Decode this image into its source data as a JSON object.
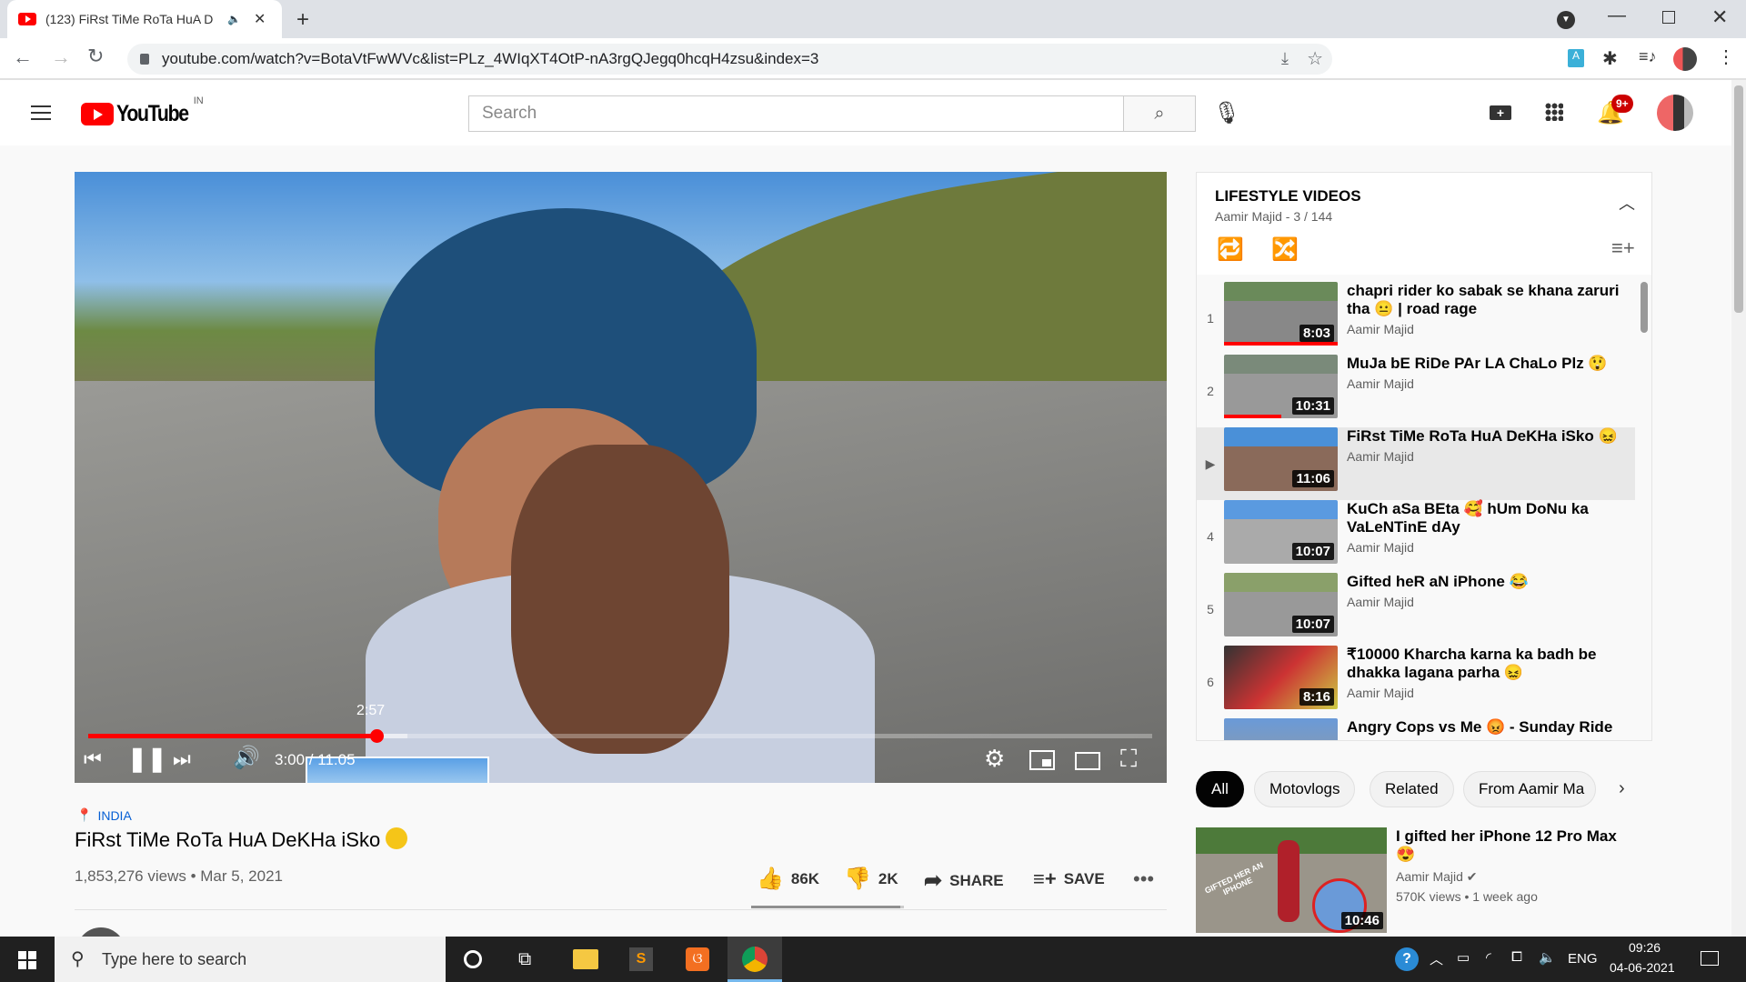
{
  "browser": {
    "tab_title": "(123) FiRst TiMe RoTa HuA D",
    "url": "youtube.com/watch?v=BotaVtFwWVc&list=PLz_4WIqXT4OtP-nA3rgQJegq0hcqH4zsu&index=3"
  },
  "header": {
    "logo": "YouTube",
    "region": "IN",
    "search_placeholder": "Search",
    "notif_badge": "9+"
  },
  "player": {
    "hover_time": "2:57",
    "time": "3:00 / 11:05",
    "progress": 0.271,
    "buffered": 0.3
  },
  "video": {
    "location": "INDIA",
    "title": "FiRst TiMe RoTa HuA DeKHa iSko",
    "views": "1,853,276 views • Mar 5, 2021",
    "likes": "86K",
    "dislikes": "2K",
    "share": "SHARE",
    "save": "SAVE",
    "like_ratio": 0.977
  },
  "playlist": {
    "title": "LIFESTYLE VIDEOS",
    "subtitle": "Aamir Majid - 3 / 144",
    "items": [
      {
        "num": "1",
        "title": "chapri rider ko sabak se khana zaruri tha 😐 | road rage",
        "channel": "Aamir Majid",
        "duration": "8:03"
      },
      {
        "num": "2",
        "title": "MuJa bE RiDe PAr LA ChaLo Plz 😲",
        "channel": "Aamir Majid",
        "duration": "10:31"
      },
      {
        "num": "▶",
        "title": "FiRst TiMe RoTa HuA DeKHa iSko 😖",
        "channel": "Aamir Majid",
        "duration": "11:06"
      },
      {
        "num": "4",
        "title": "KuCh aSa BEta 🥰 hUm DoNu ka VaLeNTinE dAy",
        "channel": "Aamir Majid",
        "duration": "10:07"
      },
      {
        "num": "5",
        "title": "Gifted heR aN iPhone 😂",
        "channel": "Aamir Majid",
        "duration": "10:07"
      },
      {
        "num": "6",
        "title": "₹10000 Kharcha karna ka badh be dhakka lagana parha 😖",
        "channel": "Aamir Majid",
        "duration": "8:16"
      },
      {
        "num": "",
        "title": "Angry Cops vs Me 😡 - Sunday Ride",
        "channel": "",
        "duration": ""
      }
    ]
  },
  "chips": [
    "All",
    "Motovlogs",
    "Related",
    "From Aamir Ma"
  ],
  "recommended": {
    "title": "I gifted her iPhone 12 Pro Max 😍",
    "channel": "Aamir Majid",
    "meta": "570K views • 1 week ago",
    "duration": "10:46",
    "thumb_text": "GIFTED HER AN IPHONE"
  },
  "taskbar": {
    "search_placeholder": "Type here to search",
    "lang": "ENG",
    "time": "09:26",
    "date": "04-06-2021"
  }
}
